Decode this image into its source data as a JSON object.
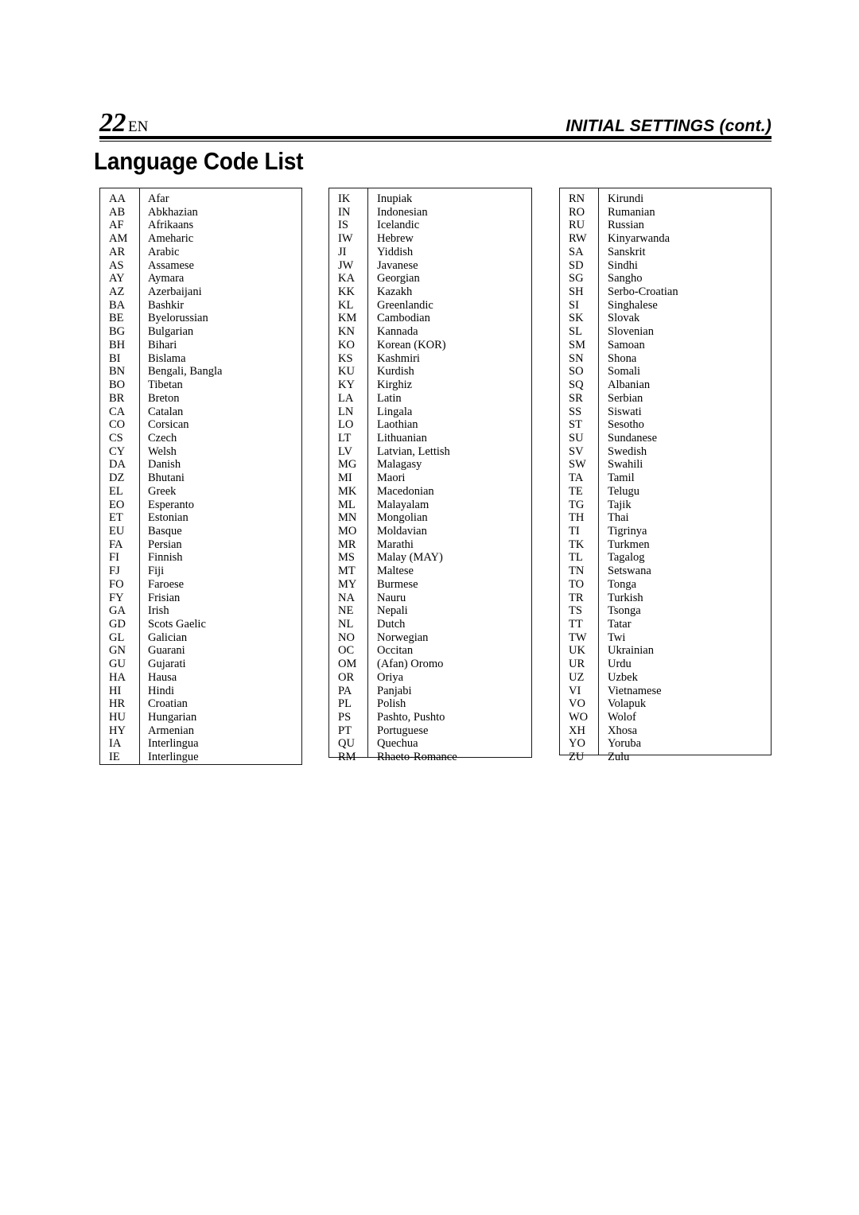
{
  "header": {
    "page_number": "22",
    "page_language": "EN",
    "section_title": "INITIAL SETTINGS (cont.)"
  },
  "title": "Language Code List",
  "table": {
    "columns": [
      {
        "id": "col-1",
        "rows": [
          {
            "code": "AA",
            "name": "Afar"
          },
          {
            "code": "AB",
            "name": "Abkhazian"
          },
          {
            "code": "AF",
            "name": "Afrikaans"
          },
          {
            "code": "AM",
            "name": "Ameharic"
          },
          {
            "code": "AR",
            "name": "Arabic"
          },
          {
            "code": "AS",
            "name": "Assamese"
          },
          {
            "code": "AY",
            "name": "Aymara"
          },
          {
            "code": "AZ",
            "name": "Azerbaijani"
          },
          {
            "code": "BA",
            "name": "Bashkir"
          },
          {
            "code": "BE",
            "name": "Byelorussian"
          },
          {
            "code": "BG",
            "name": "Bulgarian"
          },
          {
            "code": "BH",
            "name": "Bihari"
          },
          {
            "code": "BI",
            "name": "Bislama"
          },
          {
            "code": "BN",
            "name": "Bengali, Bangla"
          },
          {
            "code": "BO",
            "name": "Tibetan"
          },
          {
            "code": "BR",
            "name": "Breton"
          },
          {
            "code": "CA",
            "name": "Catalan"
          },
          {
            "code": "CO",
            "name": "Corsican"
          },
          {
            "code": "CS",
            "name": "Czech"
          },
          {
            "code": "CY",
            "name": "Welsh"
          },
          {
            "code": "DA",
            "name": "Danish"
          },
          {
            "code": "DZ",
            "name": "Bhutani"
          },
          {
            "code": "EL",
            "name": "Greek"
          },
          {
            "code": "EO",
            "name": "Esperanto"
          },
          {
            "code": "ET",
            "name": "Estonian"
          },
          {
            "code": "EU",
            "name": "Basque"
          },
          {
            "code": "FA",
            "name": "Persian"
          },
          {
            "code": "FI",
            "name": "Finnish"
          },
          {
            "code": "FJ",
            "name": "Fiji"
          },
          {
            "code": "FO",
            "name": "Faroese"
          },
          {
            "code": "FY",
            "name": "Frisian"
          },
          {
            "code": "GA",
            "name": "Irish"
          },
          {
            "code": "GD",
            "name": "Scots Gaelic"
          },
          {
            "code": "GL",
            "name": "Galician"
          },
          {
            "code": "GN",
            "name": "Guarani"
          },
          {
            "code": "GU",
            "name": "Gujarati"
          },
          {
            "code": "HA",
            "name": "Hausa"
          },
          {
            "code": "HI",
            "name": "Hindi"
          },
          {
            "code": "HR",
            "name": "Croatian"
          },
          {
            "code": "HU",
            "name": "Hungarian"
          },
          {
            "code": "HY",
            "name": "Armenian"
          },
          {
            "code": "IA",
            "name": "Interlingua"
          },
          {
            "code": "IE",
            "name": "Interlingue"
          }
        ]
      },
      {
        "id": "col-2",
        "rows": [
          {
            "code": "IK",
            "name": "Inupiak"
          },
          {
            "code": "IN",
            "name": "Indonesian"
          },
          {
            "code": "IS",
            "name": "Icelandic"
          },
          {
            "code": "IW",
            "name": "Hebrew"
          },
          {
            "code": "JI",
            "name": "Yiddish"
          },
          {
            "code": "JW",
            "name": "Javanese"
          },
          {
            "code": "KA",
            "name": "Georgian"
          },
          {
            "code": "KK",
            "name": "Kazakh"
          },
          {
            "code": "KL",
            "name": "Greenlandic"
          },
          {
            "code": "KM",
            "name": "Cambodian"
          },
          {
            "code": "KN",
            "name": "Kannada"
          },
          {
            "code": "KO",
            "name": "Korean (KOR)"
          },
          {
            "code": "KS",
            "name": "Kashmiri"
          },
          {
            "code": "KU",
            "name": "Kurdish"
          },
          {
            "code": "KY",
            "name": "Kirghiz"
          },
          {
            "code": "LA",
            "name": "Latin"
          },
          {
            "code": "LN",
            "name": "Lingala"
          },
          {
            "code": "LO",
            "name": "Laothian"
          },
          {
            "code": "LT",
            "name": "Lithuanian"
          },
          {
            "code": "LV",
            "name": "Latvian, Lettish"
          },
          {
            "code": "MG",
            "name": "Malagasy"
          },
          {
            "code": "MI",
            "name": "Maori"
          },
          {
            "code": "MK",
            "name": "Macedonian"
          },
          {
            "code": "ML",
            "name": "Malayalam"
          },
          {
            "code": "MN",
            "name": "Mongolian"
          },
          {
            "code": "MO",
            "name": "Moldavian"
          },
          {
            "code": "MR",
            "name": "Marathi"
          },
          {
            "code": "MS",
            "name": "Malay (MAY)"
          },
          {
            "code": "MT",
            "name": "Maltese"
          },
          {
            "code": "MY",
            "name": "Burmese"
          },
          {
            "code": "NA",
            "name": "Nauru"
          },
          {
            "code": "NE",
            "name": "Nepali"
          },
          {
            "code": "NL",
            "name": "Dutch"
          },
          {
            "code": "NO",
            "name": "Norwegian"
          },
          {
            "code": "OC",
            "name": "Occitan"
          },
          {
            "code": "OM",
            "name": "(Afan) Oromo"
          },
          {
            "code": "OR",
            "name": "Oriya"
          },
          {
            "code": "PA",
            "name": "Panjabi"
          },
          {
            "code": "PL",
            "name": "Polish"
          },
          {
            "code": "PS",
            "name": "Pashto, Pushto"
          },
          {
            "code": "PT",
            "name": "Portuguese"
          },
          {
            "code": "QU",
            "name": "Quechua"
          },
          {
            "code": "RM",
            "name": "Rhaeto-Romance"
          }
        ]
      },
      {
        "id": "col-3",
        "rows": [
          {
            "code": "RN",
            "name": "Kirundi"
          },
          {
            "code": "RO",
            "name": "Rumanian"
          },
          {
            "code": "RU",
            "name": "Russian"
          },
          {
            "code": "RW",
            "name": "Kinyarwanda"
          },
          {
            "code": "SA",
            "name": "Sanskrit"
          },
          {
            "code": "SD",
            "name": "Sindhi"
          },
          {
            "code": "SG",
            "name": "Sangho"
          },
          {
            "code": "SH",
            "name": "Serbo-Croatian"
          },
          {
            "code": "SI",
            "name": "Singhalese"
          },
          {
            "code": "SK",
            "name": "Slovak"
          },
          {
            "code": "SL",
            "name": "Slovenian"
          },
          {
            "code": "SM",
            "name": "Samoan"
          },
          {
            "code": "SN",
            "name": "Shona"
          },
          {
            "code": "SO",
            "name": "Somali"
          },
          {
            "code": "SQ",
            "name": "Albanian"
          },
          {
            "code": "SR",
            "name": "Serbian"
          },
          {
            "code": "SS",
            "name": "Siswati"
          },
          {
            "code": "ST",
            "name": "Sesotho"
          },
          {
            "code": "SU",
            "name": "Sundanese"
          },
          {
            "code": "SV",
            "name": "Swedish"
          },
          {
            "code": "SW",
            "name": "Swahili"
          },
          {
            "code": "TA",
            "name": "Tamil"
          },
          {
            "code": "TE",
            "name": "Telugu"
          },
          {
            "code": "TG",
            "name": "Tajik"
          },
          {
            "code": "TH",
            "name": "Thai"
          },
          {
            "code": "TI",
            "name": "Tigrinya"
          },
          {
            "code": "TK",
            "name": "Turkmen"
          },
          {
            "code": "TL",
            "name": "Tagalog"
          },
          {
            "code": "TN",
            "name": "Setswana"
          },
          {
            "code": "TO",
            "name": "Tonga"
          },
          {
            "code": "TR",
            "name": "Turkish"
          },
          {
            "code": "TS",
            "name": "Tsonga"
          },
          {
            "code": "TT",
            "name": "Tatar"
          },
          {
            "code": "TW",
            "name": "Twi"
          },
          {
            "code": "UK",
            "name": "Ukrainian"
          },
          {
            "code": "UR",
            "name": "Urdu"
          },
          {
            "code": "UZ",
            "name": "Uzbek"
          },
          {
            "code": "VI",
            "name": "Vietnamese"
          },
          {
            "code": "VO",
            "name": "Volapuk"
          },
          {
            "code": "WO",
            "name": "Wolof"
          },
          {
            "code": "XH",
            "name": "Xhosa"
          },
          {
            "code": "YO",
            "name": "Yoruba"
          },
          {
            "code": "ZU",
            "name": "Zulu"
          }
        ]
      }
    ]
  }
}
